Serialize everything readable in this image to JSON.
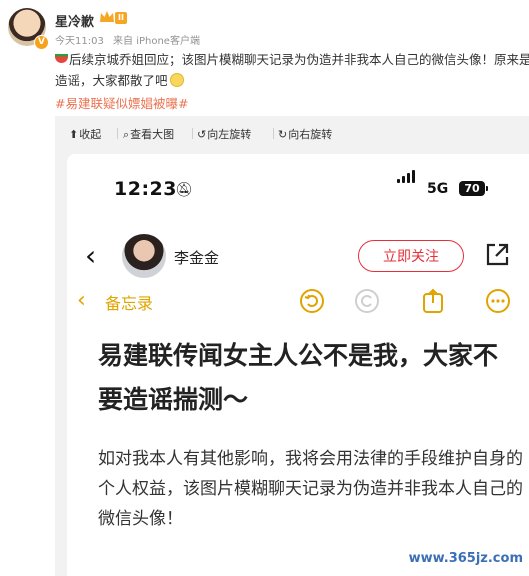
{
  "post": {
    "author": "星冷歉",
    "level": "II",
    "time": "今天11:03",
    "source": "来自 iPhone客户端",
    "text_line1": "后续京城乔姐回应；该图片模糊聊天记录为伪造并非我本人自己的微信头像！原来是",
    "text_line2": "造谣，大家都散了吧",
    "hashtag": "#易建联疑似嫖娼被曝#"
  },
  "viewer": {
    "tools": [
      "收起",
      "查看大图",
      "向左旋转",
      "向右旋转"
    ]
  },
  "phone": {
    "time": "12:23",
    "network": "5G",
    "battery": "70",
    "profile_name": "李金金",
    "follow_label": "立即关注",
    "memo_label": "备忘录",
    "headline": "易建联传闻女主人公不是我，大家不要造谣揣测～",
    "paragraph": "如对我本人有其他影响，我将会用法律的手段维护自身的个人权益，该图片模糊聊天记录为伪造并非我本人自己的微信头像！"
  },
  "watermark": "www.365jz.com"
}
